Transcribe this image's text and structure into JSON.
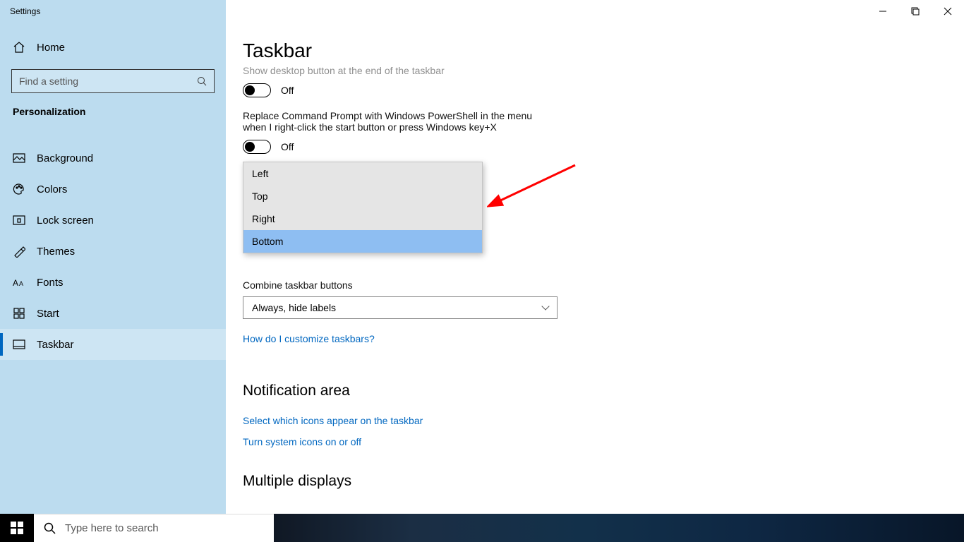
{
  "window": {
    "title": "Settings"
  },
  "sidebar": {
    "home_label": "Home",
    "search_placeholder": "Find a setting",
    "category": "Personalization",
    "items": [
      {
        "label": "Background"
      },
      {
        "label": "Colors"
      },
      {
        "label": "Lock screen"
      },
      {
        "label": "Themes"
      },
      {
        "label": "Fonts"
      },
      {
        "label": "Start"
      },
      {
        "label": "Taskbar",
        "selected": true
      }
    ]
  },
  "page": {
    "title": "Taskbar",
    "truncated_label": "Show desktop button at the end of the taskbar",
    "toggle1_state": "Off",
    "powershell_label": "Replace Command Prompt with Windows PowerShell in the menu when I right-click the start button or press Windows key+X",
    "toggle2_state": "Off",
    "location_dropdown": {
      "options": [
        "Left",
        "Top",
        "Right",
        "Bottom"
      ],
      "selected": "Bottom"
    },
    "combine_label": "Combine taskbar buttons",
    "combine_value": "Always, hide labels",
    "help_link": "How do I customize taskbars?",
    "section_notification": "Notification area",
    "link_icons": "Select which icons appear on the taskbar",
    "link_system_icons": "Turn system icons on or off",
    "section_multidisplay": "Multiple displays"
  },
  "taskbar": {
    "search_placeholder": "Type here to search"
  }
}
